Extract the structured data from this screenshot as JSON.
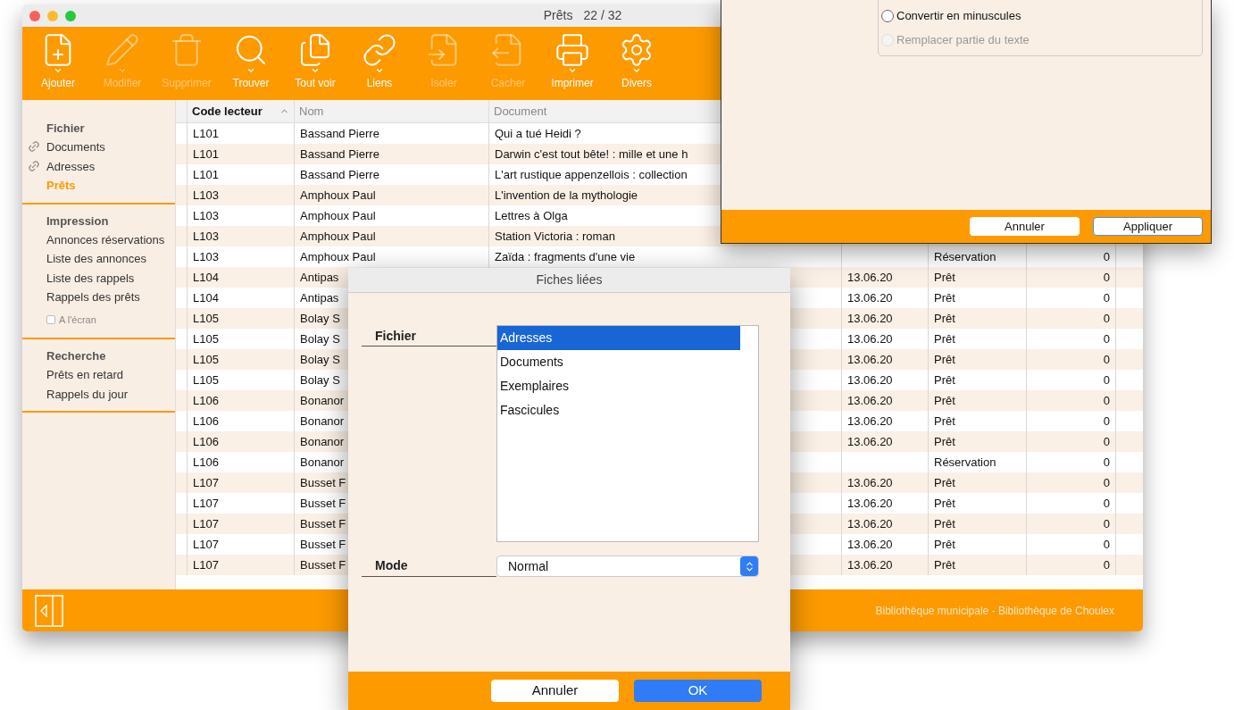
{
  "main_window": {
    "title": "Prêts",
    "record_count": "22 / 32",
    "toolbar": [
      {
        "kind": "add",
        "label": "Ajouter",
        "disabled": false,
        "menu": true
      },
      {
        "kind": "edit",
        "label": "Modifier",
        "disabled": true,
        "menu": true
      },
      {
        "kind": "delete",
        "label": "Supprimer",
        "disabled": true,
        "menu": false
      },
      {
        "kind": "find",
        "label": "Trouver",
        "disabled": false,
        "menu": true
      },
      {
        "kind": "all",
        "label": "Tout voir",
        "disabled": false,
        "menu": true
      },
      {
        "kind": "links",
        "label": "Liens",
        "disabled": false,
        "menu": true
      },
      {
        "kind": "isolate",
        "label": "Isoler",
        "disabled": true,
        "menu": false
      },
      {
        "kind": "hide",
        "label": "Cacher",
        "disabled": true,
        "menu": false
      },
      {
        "kind": "print",
        "label": "Imprimer",
        "disabled": false,
        "menu": true
      },
      {
        "kind": "misc",
        "label": "Divers",
        "disabled": false,
        "menu": true
      }
    ],
    "sidebar": [
      {
        "title": "Fichier",
        "items": [
          {
            "kind": "link",
            "label": "Documents",
            "selected": false
          },
          {
            "kind": "link",
            "label": "Adresses",
            "selected": false
          },
          {
            "kind": "item",
            "label": "Prêts",
            "selected": true
          }
        ]
      },
      {
        "title": "Impression",
        "items": [
          {
            "kind": "item",
            "label": "Annonces réservations",
            "selected": false
          },
          {
            "kind": "item",
            "label": "Liste des annonces",
            "selected": false
          },
          {
            "kind": "item",
            "label": "Liste des rappels",
            "selected": false
          },
          {
            "kind": "item",
            "label": "Rappels des prêts",
            "selected": false
          },
          {
            "kind": "checkbox",
            "label": "A l'écran",
            "checked": false
          }
        ]
      },
      {
        "title": "Recherche",
        "items": [
          {
            "kind": "item",
            "label": "Prêts en retard",
            "selected": false
          },
          {
            "kind": "item",
            "label": "Rappels du jour",
            "selected": false
          }
        ]
      }
    ],
    "table": {
      "columns": [
        {
          "label": "Code lecteur",
          "sorted": true
        },
        {
          "label": "Nom",
          "sorted": false
        },
        {
          "label": "Document",
          "sorted": false
        }
      ],
      "rows": [
        {
          "code": "L101",
          "nom": "Bassand Pierre",
          "document": "Qui a tué Heidi ?"
        },
        {
          "code": "L101",
          "nom": "Bassand Pierre",
          "document": "Darwin c'est tout bête! : mille et une h"
        },
        {
          "code": "L101",
          "nom": "Bassand Pierre",
          "document": "L'art rustique appenzellois : collection"
        },
        {
          "code": "L103",
          "nom": "Amphoux Paul",
          "document": "L'invention de la mythologie"
        },
        {
          "code": "L103",
          "nom": "Amphoux Paul",
          "document": "Lettres à Olga"
        },
        {
          "code": "L103",
          "nom": "Amphoux Paul",
          "document": "Station Victoria : roman"
        },
        {
          "code": "L103",
          "nom": "Amphoux Paul",
          "document": "Zaïda : fragments d'une vie",
          "type": "Réservation",
          "count": "0"
        },
        {
          "code": "L104",
          "nom": "Antipas",
          "date": "13.06.20",
          "type": "Prêt",
          "count": "0"
        },
        {
          "code": "L104",
          "nom": "Antipas",
          "date": "13.06.20",
          "type": "Prêt",
          "count": "0"
        },
        {
          "code": "L105",
          "nom": "Bolay S",
          "date": "13.06.20",
          "type": "Prêt",
          "count": "0"
        },
        {
          "code": "L105",
          "nom": "Bolay S",
          "date": "13.06.20",
          "type": "Prêt",
          "count": "0"
        },
        {
          "code": "L105",
          "nom": "Bolay S",
          "date": "13.06.20",
          "type": "Prêt",
          "count": "0"
        },
        {
          "code": "L105",
          "nom": "Bolay S",
          "date": "13.06.20",
          "type": "Prêt",
          "count": "0"
        },
        {
          "code": "L106",
          "nom": "Bonanor",
          "date": "13.06.20",
          "type": "Prêt",
          "count": "0"
        },
        {
          "code": "L106",
          "nom": "Bonanor",
          "date": "13.06.20",
          "type": "Prêt",
          "count": "0"
        },
        {
          "code": "L106",
          "nom": "Bonanor",
          "date": "13.06.20",
          "type": "Prêt",
          "count": "0"
        },
        {
          "code": "L106",
          "nom": "Bonanor",
          "type": "Réservation",
          "count": "0"
        },
        {
          "code": "L107",
          "nom": "Busset F",
          "date": "13.06.20",
          "type": "Prêt",
          "count": "0"
        },
        {
          "code": "L107",
          "nom": "Busset F",
          "date": "13.06.20",
          "type": "Prêt",
          "count": "0"
        },
        {
          "code": "L107",
          "nom": "Busset F",
          "date": "13.06.20",
          "type": "Prêt",
          "count": "0"
        },
        {
          "code": "L107",
          "nom": "Busset F",
          "date": "13.06.20",
          "type": "Prêt",
          "count": "0"
        },
        {
          "code": "L107",
          "nom": "Busset F",
          "date": "13.06.20",
          "type": "Prêt",
          "count": "0"
        }
      ]
    },
    "status_bar": "Bibliothèque municipale - Bibliothèque de Choulex"
  },
  "text_dialog": {
    "options": [
      {
        "label": "Convertir en minuscules",
        "selected": false,
        "disabled": false
      },
      {
        "label": "Remplacer partie du texte",
        "selected": false,
        "disabled": true
      }
    ],
    "buttons": [
      {
        "label": "Annuler",
        "default": false
      },
      {
        "label": "Appliquer",
        "default": true
      }
    ]
  },
  "linked_dialog": {
    "title": "Fiches liées",
    "file_label": "Fichier",
    "files": [
      {
        "label": "Adresses",
        "selected": true
      },
      {
        "label": "Documents",
        "selected": false
      },
      {
        "label": "Exemplaires",
        "selected": false
      },
      {
        "label": "Fascicules",
        "selected": false
      }
    ],
    "mode_label": "Mode",
    "mode_value": "Normal",
    "buttons": [
      {
        "label": "Annuler",
        "default": false
      },
      {
        "label": "OK",
        "default": true
      }
    ]
  }
}
